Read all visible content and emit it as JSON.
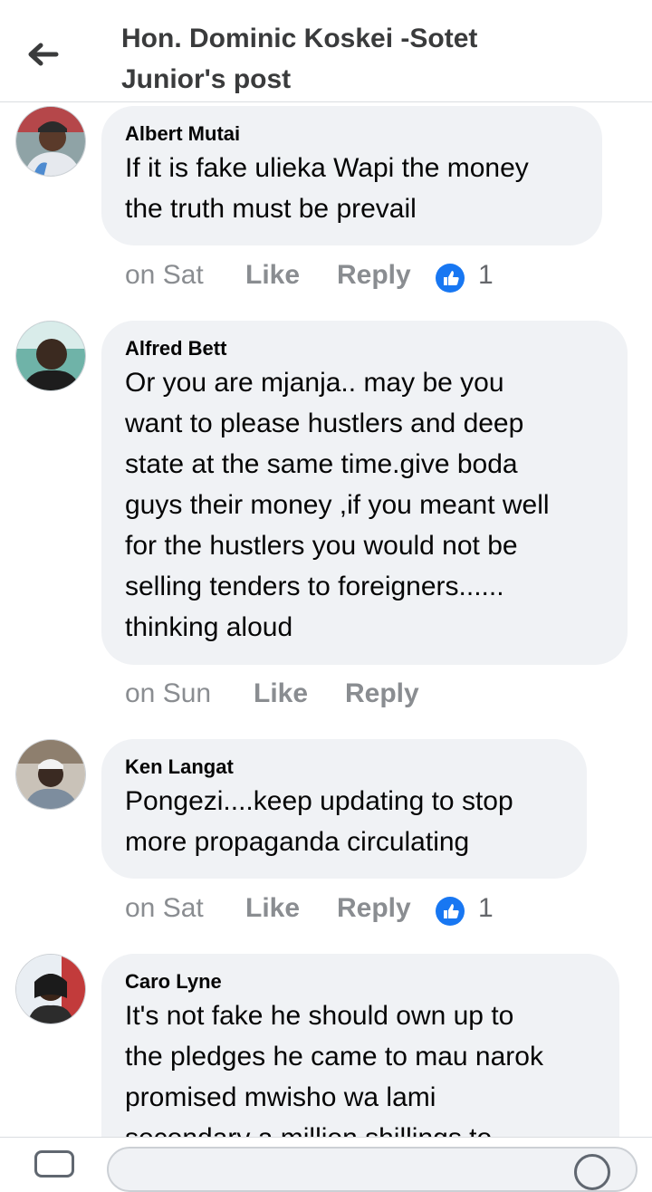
{
  "header": {
    "title_line1": "Hon. Dominic Koskei -Sotet",
    "title_line2": "Junior's post",
    "back_icon": "arrow-left-icon"
  },
  "comments": [
    {
      "author": "Albert Mutai",
      "lines": [
        "If it is fake ulieka Wapi the money",
        "the truth must be prevail"
      ],
      "time": "on Sat",
      "like_label": "Like",
      "reply_label": "Reply",
      "reaction_count": "1",
      "reaction_icon": "thumbs-up-icon"
    },
    {
      "author": "Alfred Bett",
      "lines": [
        "Or you are mjanja.. may be you",
        "want to please hustlers and deep",
        "state at the same time.give boda",
        "guys their money ,if you meant well",
        "for the hustlers you would not be",
        "selling tenders to foreigners......",
        "thinking aloud"
      ],
      "time": "on Sun",
      "like_label": "Like",
      "reply_label": "Reply"
    },
    {
      "author": "Ken Langat",
      "lines": [
        "Pongezi....keep updating to stop",
        "more propaganda circulating"
      ],
      "time": "on Sat",
      "like_label": "Like",
      "reply_label": "Reply",
      "reaction_count": "1",
      "reaction_icon": "thumbs-up-icon"
    },
    {
      "author": "Caro Lyne",
      "lines": [
        "It's not fake he should own up to",
        "the pledges he came to mau narok",
        "promised mwisho wa lami",
        "secondary a million shillings to"
      ]
    }
  ],
  "colors": {
    "accent": "#1877f2",
    "bubble": "#f0f2f5",
    "muted": "#8a8d91"
  }
}
